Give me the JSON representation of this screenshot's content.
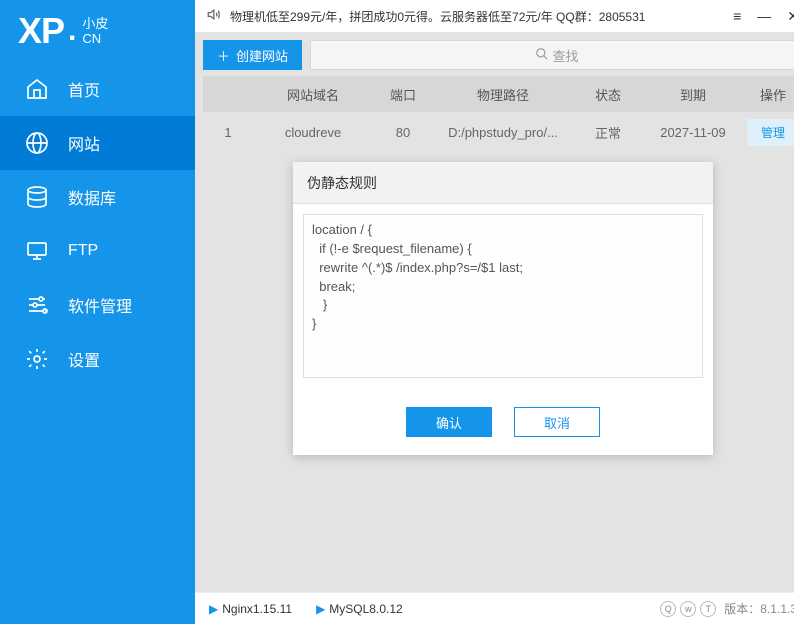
{
  "logo": {
    "xp": "XP",
    "dot": ".",
    "small_cn": "小皮",
    "cn": "CN"
  },
  "titlebar": {
    "notice": "物理机低至299元/年，拼团成功0元得。云服务器低至72元/年  QQ群：2805531"
  },
  "sidebar": {
    "items": [
      {
        "label": "首页"
      },
      {
        "label": "网站"
      },
      {
        "label": "数据库"
      },
      {
        "label": "FTP"
      },
      {
        "label": "软件管理"
      },
      {
        "label": "设置"
      }
    ]
  },
  "toolbar": {
    "create_label": "创建网站",
    "search_placeholder": "查找"
  },
  "table": {
    "headers": [
      "网站域名",
      "端口",
      "物理路径",
      "状态",
      "到期",
      "操作"
    ],
    "rows": [
      {
        "idx": "1",
        "domain": "cloudreve",
        "port": "80",
        "path": "D:/phpstudy_pro/...",
        "status": "正常",
        "date": "2027-11-09",
        "action": "管理"
      }
    ]
  },
  "dialog": {
    "title": "伪静态规则",
    "rule": "location / {\n  if (!-e $request_filename) {\n  rewrite ^(.*)$ /index.php?s=/$1 last;\n  break;\n   }\n}",
    "confirm": "确认",
    "cancel": "取消"
  },
  "statusbar": {
    "services": [
      "Nginx1.15.11",
      "MySQL8.0.12"
    ],
    "version": "版本：8.1.1.3"
  }
}
